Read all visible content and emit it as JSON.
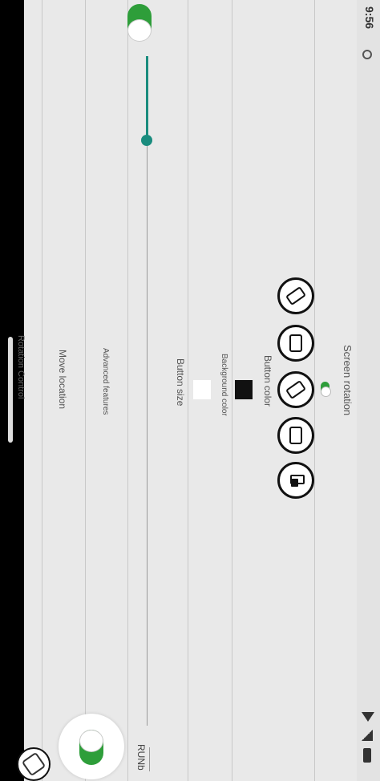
{
  "status": {
    "time": "9:56",
    "icons": [
      "battery-icon",
      "signal-icon",
      "wifi-icon",
      "sim-icon"
    ]
  },
  "settings": {
    "screen_rotation_label": "Screen rotation",
    "button_color_label": "Button color",
    "background_color_label": "Background color",
    "button_size_label": "Button size",
    "advanced_features_label": "Advanced features",
    "move_location_label": "Move location",
    "clipped_bottom_label": "Rotation Control"
  },
  "colors": {
    "button_color": "#111111",
    "background_color": "#ffffff",
    "accent_green": "#2e9e3a",
    "slider_teal": "#1a8c7e"
  },
  "button_size_slider": {
    "value_fraction": 0.15
  },
  "icons": [
    "lock-rotation-icon",
    "portrait-icon",
    "landscape-rotate-icon",
    "portrait-rotate-icon",
    "auto-rotate-icon"
  ],
  "bottom_logo_text": "RUNb"
}
